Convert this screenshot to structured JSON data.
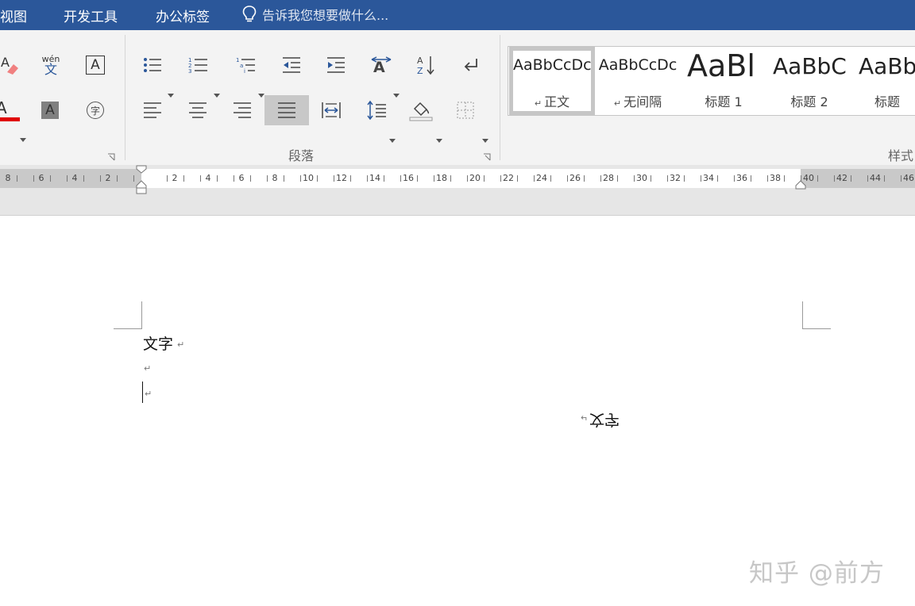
{
  "menubar": {
    "tabs": [
      "视图",
      "开发工具",
      "办公标签"
    ],
    "tell_me": "告诉我您想要做什么..."
  },
  "ribbon": {
    "font_group": {
      "pinyin_top": "wén",
      "pinyin_bottom": "文",
      "char_border_letter": "A",
      "char_shading_letter": "A",
      "enclose_char": "字",
      "font_color_letter": "A",
      "font_color": "#e00000"
    },
    "paragraph_group": {
      "label": "段落"
    },
    "styles_group": {
      "label": "样式",
      "items": [
        {
          "sample": "AaBbCcDc",
          "name": "正文",
          "mark": "↵"
        },
        {
          "sample": "AaBbCcDc",
          "name": "无间隔",
          "mark": "↵"
        },
        {
          "sample": "AaBl",
          "name": "标题 1",
          "mark": ""
        },
        {
          "sample": "AaBbC",
          "name": "标题 2",
          "mark": ""
        },
        {
          "sample": "AaBb",
          "name": "标题",
          "mark": ""
        }
      ]
    }
  },
  "ruler": {
    "left_labels": [
      "8",
      "6",
      "4",
      "2"
    ],
    "right_labels": [
      "2",
      "4",
      "6",
      "8",
      "10",
      "12",
      "14",
      "16",
      "18",
      "20",
      "22",
      "24",
      "26",
      "28",
      "30",
      "32",
      "34",
      "36",
      "38",
      "40",
      "42",
      "44",
      "46"
    ]
  },
  "document": {
    "line1": "文字",
    "paragraph_mark": "↵",
    "mirrored_text": "文字"
  },
  "watermark": "知乎 @前方"
}
